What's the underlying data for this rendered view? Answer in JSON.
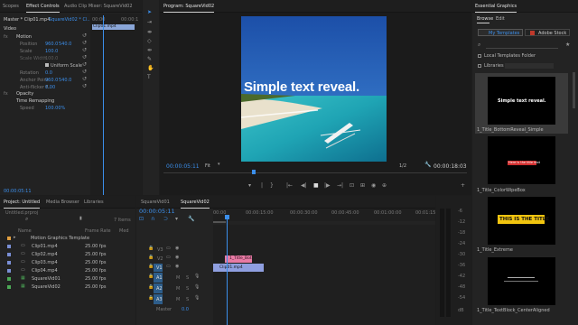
{
  "effect_controls": {
    "tabs": [
      "Scopes",
      "Effect Controls",
      "Audio Clip Mixer: SquareVid02"
    ],
    "source": "Master * Clip01.mp4",
    "sequence": "SquareVid02 * Cl...",
    "time": "00:00",
    "time_end": "00:00:1",
    "clip_bar": "Clip01.mp4",
    "section_video": "Video",
    "motion": "Motion",
    "props": [
      {
        "name": "Position",
        "v1": "960.0",
        "v2": "540.0"
      },
      {
        "name": "Scale",
        "v1": "100.0",
        "v2": ""
      },
      {
        "name": "Scale Width",
        "v1": "100.0",
        "v2": ""
      },
      {
        "name": "",
        "v1": "",
        "v2": ""
      },
      {
        "name": "Rotation",
        "v1": "0.0",
        "v2": ""
      },
      {
        "name": "Anchor Point",
        "v1": "960.0",
        "v2": "540.0"
      },
      {
        "name": "Anti-flicker F...",
        "v1": "0.00",
        "v2": ""
      }
    ],
    "uniform_scale": "Uniform Scale",
    "opacity": "Opacity",
    "time_remap": "Time Remapping",
    "speed_label": "Speed",
    "speed_value": "100.00%",
    "bottom_time": "00:00:05:11"
  },
  "program": {
    "title": "Program: SquareVid02",
    "overlay_text": "Simple text reveal.",
    "timecode": "00:00:05:11",
    "fit": "Fit",
    "resolution": "1/2",
    "duration": "00:00:18:03",
    "transport": [
      "{",
      "}",
      "|←",
      "◀|",
      "◀",
      "▶",
      "|▶",
      "→|",
      "⊡",
      "⊞",
      "📷",
      "⊕",
      "+"
    ]
  },
  "project": {
    "tabs": [
      "Project: Untitled",
      "Media Browser",
      "Libraries"
    ],
    "file": "Untitled.prproj",
    "items_count": "7 Items",
    "columns": [
      "Name",
      "Frame Rate",
      "Med"
    ],
    "items": [
      {
        "name": "Motion Graphics Template",
        "fps": "",
        "color": "#e2a040",
        "type": "folder"
      },
      {
        "name": "Clip01.mp4",
        "fps": "25.00 fps",
        "color": "#7a8fd6",
        "type": "clip"
      },
      {
        "name": "Clip02.mp4",
        "fps": "25.00 fps",
        "color": "#7a8fd6",
        "type": "clip"
      },
      {
        "name": "Clip03.mp4",
        "fps": "25.00 fps",
        "color": "#7a8fd6",
        "type": "clip"
      },
      {
        "name": "Clip04.mp4",
        "fps": "25.00 fps",
        "color": "#7a8fd6",
        "type": "clip"
      },
      {
        "name": "SquareVid01",
        "fps": "25.00 fps",
        "color": "#4caa57",
        "type": "seq"
      },
      {
        "name": "SquareVid02",
        "fps": "25.00 fps",
        "color": "#4caa57",
        "type": "seq"
      }
    ]
  },
  "timeline": {
    "tabs": [
      "SquareVid01",
      "SquareVid02"
    ],
    "timecode": "00:00:05:11",
    "ruler": [
      "00:00",
      "00:00:15:00",
      "00:00:30:00",
      "00:00:45:00",
      "00:01:00:00",
      "00:01:15:00"
    ],
    "tracks": [
      {
        "name": "V3",
        "kind": "video"
      },
      {
        "name": "V2",
        "kind": "video"
      },
      {
        "name": "V1",
        "kind": "video"
      },
      {
        "name": "A1",
        "kind": "audio"
      },
      {
        "name": "A2",
        "kind": "audio"
      },
      {
        "name": "A3",
        "kind": "audio"
      }
    ],
    "master": "Master",
    "master_val": "0.0",
    "clip_title": "1_Title_Bot",
    "clip_video": "Clip01.mp4"
  },
  "meter": {
    "labels": [
      "-6",
      "-12",
      "-18",
      "-24",
      "-30",
      "-36",
      "-42",
      "-48",
      "-54",
      "dB"
    ]
  },
  "essential_graphics": {
    "title": "Essential Graphics",
    "tabs": [
      "Browse",
      "Edit"
    ],
    "my_templates": "My Templates",
    "adobe_stock": "Adobe Stock",
    "local_folder": "Local Templates Folder",
    "libraries": "Libraries",
    "templates": [
      {
        "name": "1_Title_BottomReveal_Simple",
        "preview": "Simple text reveal."
      },
      {
        "name": "1_Title_ColorWipeBox",
        "preview": "Here is the title text"
      },
      {
        "name": "1_Title_Extreme",
        "preview": "THIS IS THE TITLE"
      },
      {
        "name": "1_Title_TextBlock_CenterAligned",
        "preview": ""
      }
    ]
  },
  "colors": {
    "accent": "#3b8eea",
    "title_clip": "#e87ba5",
    "video_clip": "#8f9fe0",
    "audio_track": "#2d5d8a"
  }
}
